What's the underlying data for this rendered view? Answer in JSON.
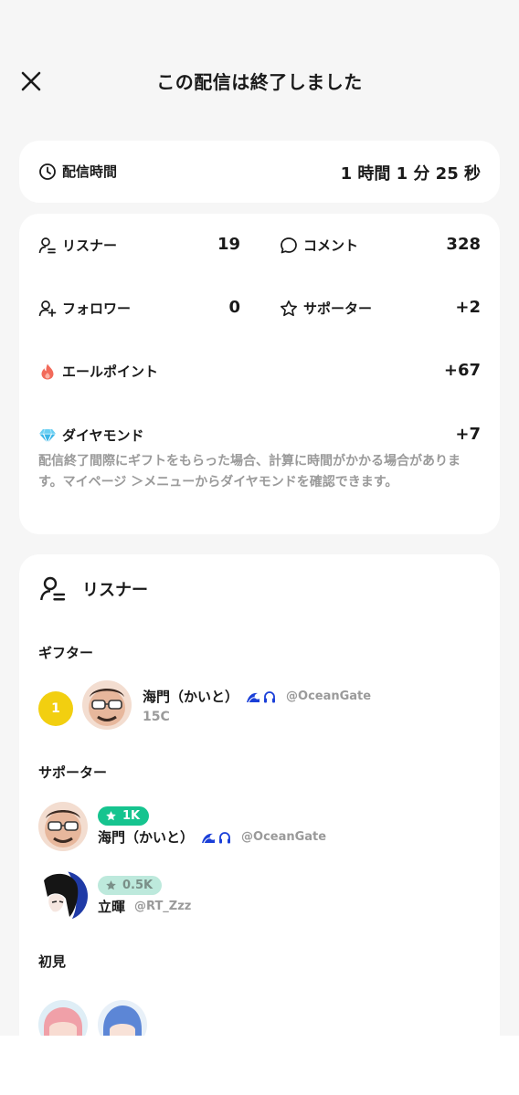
{
  "header": {
    "title": "この配信は終了しました"
  },
  "duration": {
    "label": "配信時間",
    "value": "1 時間 1 分 25 秒"
  },
  "stats": {
    "listeners": {
      "label": "リスナー",
      "value": "19"
    },
    "comments": {
      "label": "コメント",
      "value": "328"
    },
    "followers": {
      "label": "フォロワー",
      "value": "0"
    },
    "supporters": {
      "label": "サポーター",
      "value": "+2"
    },
    "yell_points": {
      "label": "エールポイント",
      "value": "+67"
    },
    "diamonds": {
      "label": "ダイヤモンド",
      "value": "+7"
    },
    "note": "配信終了間際にギフトをもらった場合、計算に時間がかかる場合があります。マイページ ＞メニューからダイヤモンドを確認できます。"
  },
  "listeners_section": {
    "title": "リスナー",
    "gifter_label": "ギフター",
    "gifters": [
      {
        "rank": "1",
        "name": "海門（かいと）",
        "handle": "@OceanGate",
        "amount": "15C"
      }
    ],
    "supporter_label": "サポーター",
    "supporters": [
      {
        "name": "海門（かいと）",
        "handle": "@OceanGate",
        "badge": "1K"
      },
      {
        "name": "立暉",
        "handle": "@RT_Zzz",
        "badge": "0.5K"
      }
    ],
    "first_time_label": "初見"
  },
  "colors": {
    "accent_green": "#16c48f",
    "rank_gold": "#f2cf10",
    "flame": "#f26a5a",
    "diamond": "#39b6e8",
    "badge_blue": "#1a3fd8"
  },
  "icons": [
    "close-icon",
    "clock-icon",
    "listener-icon",
    "comment-icon",
    "follower-add-icon",
    "star-icon",
    "flame-icon",
    "diamond-icon",
    "ocean-badge-icon",
    "headset-badge-icon"
  ]
}
